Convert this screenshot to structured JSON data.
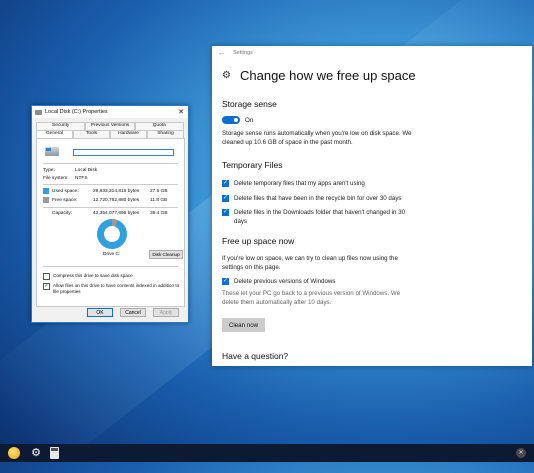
{
  "settings": {
    "breadcrumb": "Settings",
    "title": "Change how we free up space",
    "storage_sense": {
      "heading": "Storage sense",
      "toggle_label": "On",
      "toggle_on": true,
      "description": "Storage sense runs automatically when you're low on disk space. We cleaned up 10.6 GB of space in the past month."
    },
    "temp_files": {
      "heading": "Temporary Files",
      "options": [
        {
          "label": "Delete temporary files that my apps aren't using",
          "checked": true
        },
        {
          "label": "Delete files that have been in the recycle bin for over 30 days",
          "checked": true
        },
        {
          "label": "Delete files in the Downloads folder that haven't changed in 30 days",
          "checked": true
        }
      ]
    },
    "free_up": {
      "heading": "Free up space now",
      "description": "If you're low on space, we can try to clean up files now using the settings on this page.",
      "option_label": "Delete previous versions of Windows",
      "option_checked": true,
      "note": "These let your PC go back to a previous version of Windows. We delete them automatically after 10 days.",
      "button": "Clean now"
    },
    "question_heading": "Have a question?"
  },
  "properties": {
    "title": "Local Disk (C:) Properties",
    "tabs_row1": [
      "Security",
      "Previous Versions",
      "Quota"
    ],
    "tabs_row2": [
      "General",
      "Tools",
      "Hardware",
      "Sharing"
    ],
    "selected_tab": "General",
    "name_value": "",
    "type_label": "Type:",
    "type_value": "Local Disk",
    "fs_label": "File system:",
    "fs_value": "NTFS",
    "used_label": "Used space:",
    "used_bytes": "29,633,314,816 bytes",
    "used_gb": "27.5 GB",
    "free_label": "Free space:",
    "free_bytes": "12,720,762,880 bytes",
    "free_gb": "11.8 GB",
    "capacity_label": "Capacity:",
    "capacity_bytes": "42,354,077,696 bytes",
    "capacity_gb": "39.4 GB",
    "drive_label": "Drive C:",
    "cleanup_button": "Disk Cleanup",
    "compress_label": "Compress this drive to save disk space",
    "compress_checked": false,
    "index_label": "Allow files on this drive to have contents indexed in addition to file properties",
    "index_checked": true,
    "ok": "OK",
    "cancel": "Cancel",
    "apply": "Apply",
    "colors": {
      "used": "#31a0e0",
      "free": "#9a9a9a"
    }
  },
  "taskbar": {
    "icons": [
      "app-icon",
      "settings-icon",
      "calculator-icon",
      "close-icon"
    ]
  }
}
